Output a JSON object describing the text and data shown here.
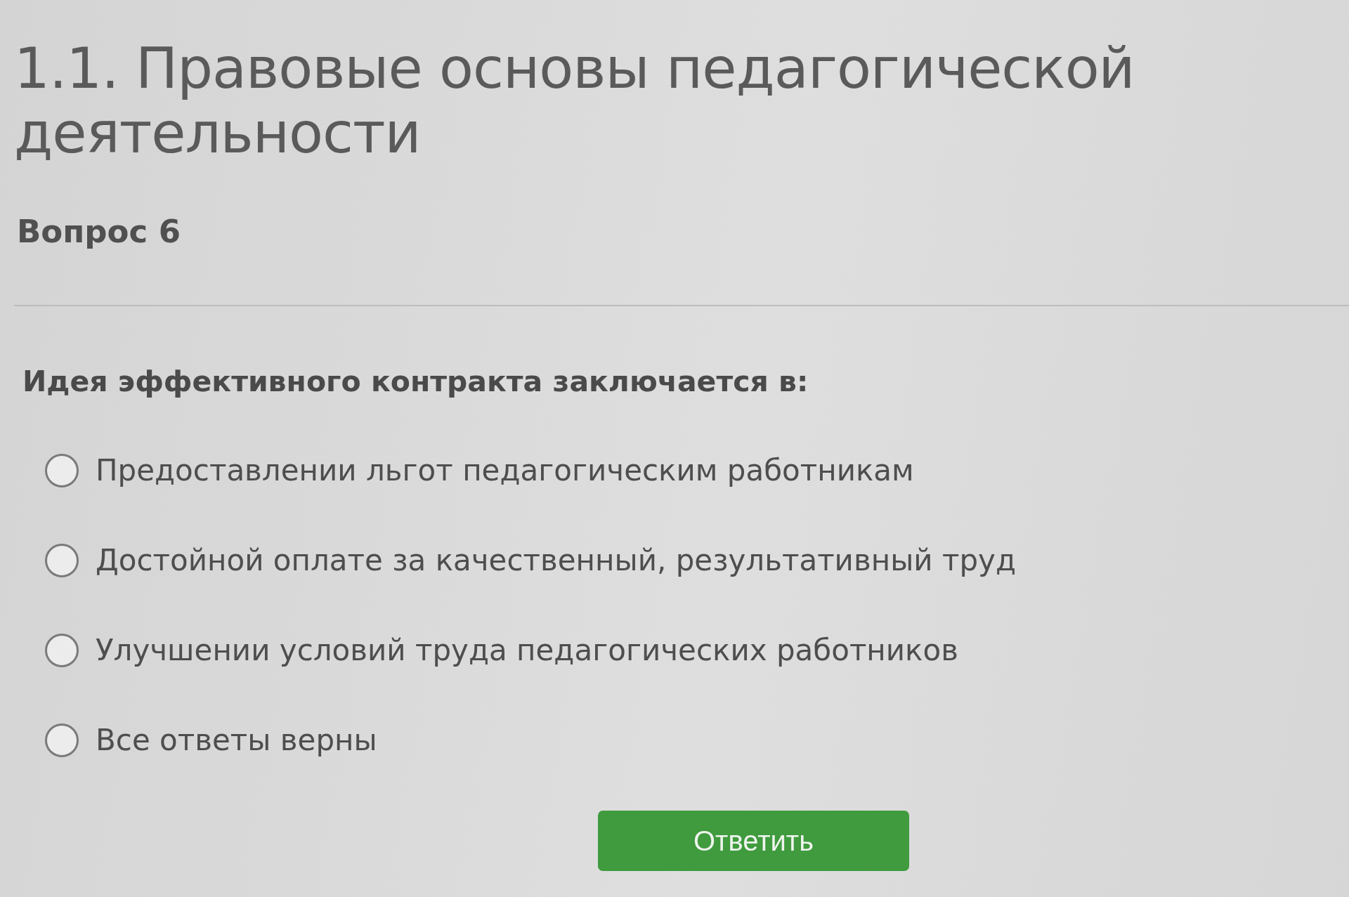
{
  "page": {
    "title": "1.1. Правовые основы педагогической деятельности"
  },
  "question": {
    "number": "Вопрос 6",
    "text": "Идея эффективного контракта заключается в:",
    "options": [
      {
        "label": "Предоставлении льгот педагогическим работникам",
        "selected": false
      },
      {
        "label": "Достойной оплате за качественный, результативный труд",
        "selected": false
      },
      {
        "label": "Улучшении условий труда педагогических работников",
        "selected": false
      },
      {
        "label": "Все ответы верны",
        "selected": false
      }
    ]
  },
  "submit_button": "Ответить"
}
